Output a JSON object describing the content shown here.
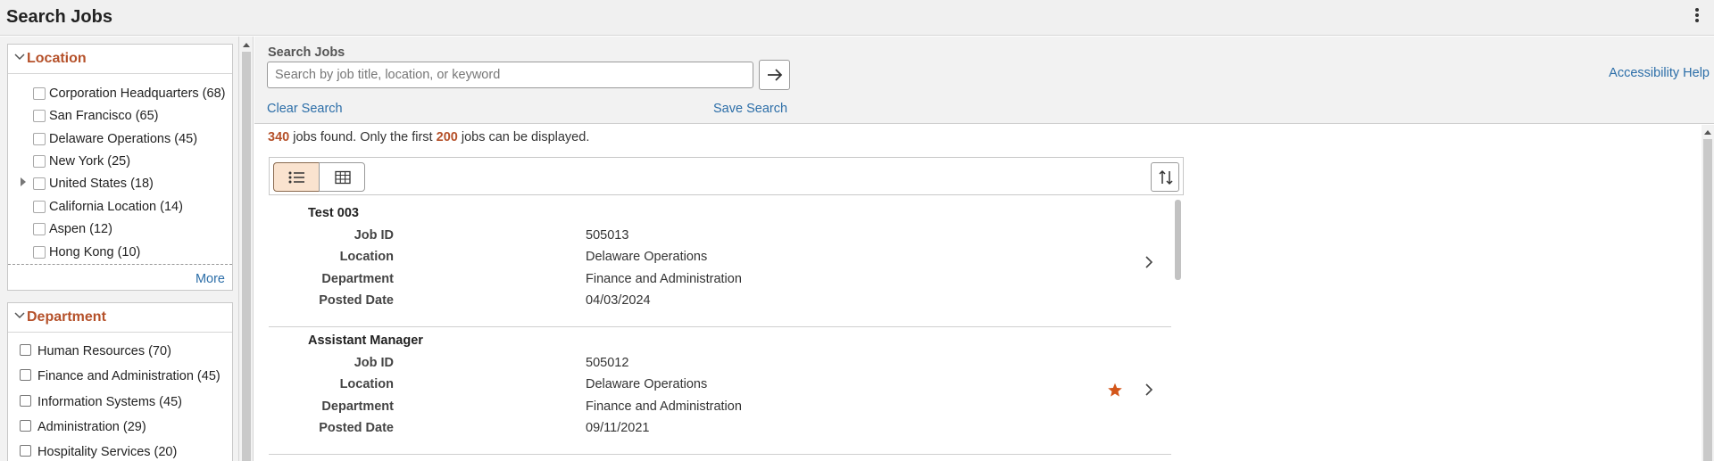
{
  "header": {
    "title": "Search Jobs",
    "menu_icon": "more-vertical-icon"
  },
  "location_facet": {
    "title": "Location",
    "items": [
      {
        "label": "Corporation Headquarters (68)"
      },
      {
        "label": "San Francisco (65)"
      },
      {
        "label": "Delaware Operations (45)"
      },
      {
        "label": "New York (25)"
      },
      {
        "label": "United States (18)",
        "expandable": true
      },
      {
        "label": "California Location (14)"
      },
      {
        "label": "Aspen (12)"
      },
      {
        "label": "Hong Kong (10)"
      }
    ],
    "more_label": "More"
  },
  "department_facet": {
    "title": "Department",
    "items": [
      {
        "label": "Human Resources (70)"
      },
      {
        "label": "Finance and Administration (45)"
      },
      {
        "label": "Information Systems (45)"
      },
      {
        "label": "Administration (29)"
      },
      {
        "label": "Hospitality Services (20)"
      }
    ]
  },
  "search": {
    "label": "Search Jobs",
    "value": "",
    "placeholder": "Search by job title, location, or keyword",
    "clear_label": "Clear Search",
    "save_label": "Save Search",
    "accessibility_label": "Accessibility Help"
  },
  "results": {
    "found_count": "340",
    "found_text": " jobs found. Only the first ",
    "display_limit": "200",
    "display_text": " jobs can be displayed."
  },
  "field_labels": {
    "job_id": "Job ID",
    "location": "Location",
    "department": "Department",
    "posted_date": "Posted Date"
  },
  "jobs": [
    {
      "title": "Test 003",
      "job_id": "505013",
      "location": "Delaware Operations",
      "department": "Finance and Administration",
      "posted_date": "04/03/2024",
      "favorite": false
    },
    {
      "title": "Assistant Manager",
      "job_id": "505012",
      "location": "Delaware Operations",
      "department": "Finance and Administration",
      "posted_date": "09/11/2021",
      "favorite": true
    }
  ],
  "colors": {
    "accent": "#b5512a",
    "link": "#2c6ea8",
    "favorite_star": "#d3561a"
  }
}
